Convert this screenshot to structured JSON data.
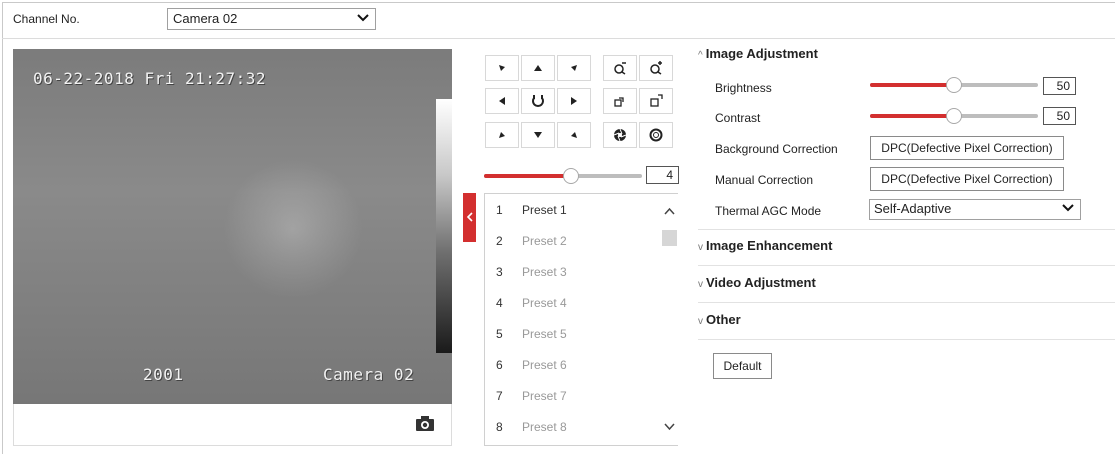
{
  "channel": {
    "label": "Channel No.",
    "selected": "Camera 02"
  },
  "video": {
    "osd_datetime": "06-22-2018 Fri 21:27:32",
    "osd_code": "2001",
    "osd_camera": "Camera 02",
    "snapshot_icon": "camera-icon"
  },
  "ptz": {
    "buttons": [
      "arrow-up-left-icon",
      "arrow-up-icon",
      "arrow-up-right-icon",
      "zoom-out-icon",
      "zoom-in-icon",
      "arrow-left-icon",
      "auto-rotate-icon",
      "arrow-right-icon",
      "focus-near-icon",
      "focus-far-icon",
      "arrow-down-left-icon",
      "arrow-down-icon",
      "arrow-down-right-icon",
      "iris-close-icon",
      "iris-open-icon"
    ],
    "speed_value": "4",
    "speed_fraction": 0.55
  },
  "presets": {
    "items": [
      {
        "num": "1",
        "name": "Preset 1"
      },
      {
        "num": "2",
        "name": "Preset 2"
      },
      {
        "num": "3",
        "name": "Preset 3"
      },
      {
        "num": "4",
        "name": "Preset 4"
      },
      {
        "num": "5",
        "name": "Preset 5"
      },
      {
        "num": "6",
        "name": "Preset 6"
      },
      {
        "num": "7",
        "name": "Preset 7"
      },
      {
        "num": "8",
        "name": "Preset 8"
      }
    ]
  },
  "settings": {
    "image_adjustment": {
      "title": "Image Adjustment",
      "brightness_label": "Brightness",
      "brightness_value": "50",
      "brightness_fraction": 0.5,
      "contrast_label": "Contrast",
      "contrast_value": "50",
      "contrast_fraction": 0.5,
      "background_correction_label": "Background Correction",
      "background_correction_button": "DPC(Defective Pixel Correction)",
      "manual_correction_label": "Manual Correction",
      "manual_correction_button": "DPC(Defective Pixel Correction)",
      "agc_label": "Thermal AGC Mode",
      "agc_value": "Self-Adaptive"
    },
    "image_enhancement": "Image Enhancement",
    "video_adjustment": "Video Adjustment",
    "other": "Other",
    "default_button": "Default"
  },
  "colors": {
    "accent": "#d32f2f",
    "track": "#bdbdbd"
  }
}
